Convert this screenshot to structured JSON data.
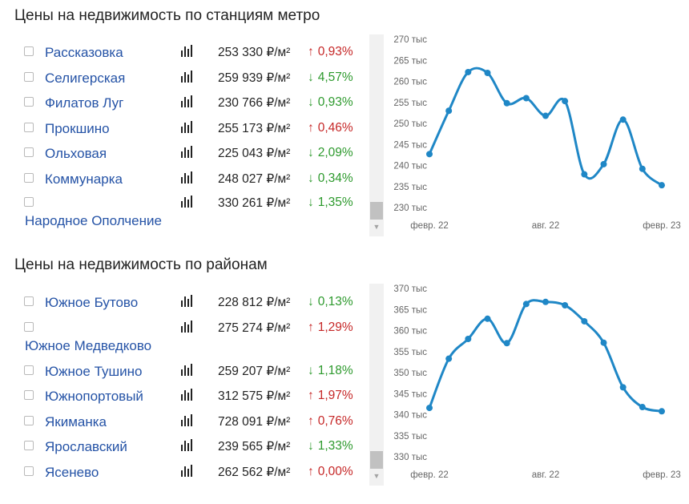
{
  "sections": [
    {
      "title": "Цены на недвижимость по станциям метро",
      "rows": [
        {
          "name": "Рассказовка",
          "price": "253 330 ₽/м²",
          "dir": "up",
          "arrow": "↑",
          "change": "0,93%",
          "wrap": false
        },
        {
          "name": "Селигерская",
          "price": "259 939 ₽/м²",
          "dir": "down",
          "arrow": "↓",
          "change": "4,57%",
          "wrap": false
        },
        {
          "name": "Филатов Луг",
          "price": "230 766 ₽/м²",
          "dir": "down",
          "arrow": "↓",
          "change": "0,93%",
          "wrap": false
        },
        {
          "name": "Прокшино",
          "price": "255 173 ₽/м²",
          "dir": "up",
          "arrow": "↑",
          "change": "0,46%",
          "wrap": false
        },
        {
          "name": "Ольховая",
          "price": "225 043 ₽/м²",
          "dir": "down",
          "arrow": "↓",
          "change": "2,09%",
          "wrap": false
        },
        {
          "name": "Коммунарка",
          "price": "248 027 ₽/м²",
          "dir": "down",
          "arrow": "↓",
          "change": "0,34%",
          "wrap": false
        },
        {
          "name": "Народное Ополчение",
          "price": "330 261 ₽/м²",
          "dir": "down",
          "arrow": "↓",
          "change": "1,35%",
          "wrap": true
        }
      ]
    },
    {
      "title": "Цены на недвижимость по районам",
      "rows": [
        {
          "name": "Южное Бутово",
          "price": "228 812 ₽/м²",
          "dir": "down",
          "arrow": "↓",
          "change": "0,13%",
          "wrap": false
        },
        {
          "name": "Южное Медведково",
          "price": "275 274 ₽/м²",
          "dir": "up",
          "arrow": "↑",
          "change": "1,29%",
          "wrap": true
        },
        {
          "name": "Южное Тушино",
          "price": "259 207 ₽/м²",
          "dir": "down",
          "arrow": "↓",
          "change": "1,18%",
          "wrap": false
        },
        {
          "name": "Южнопортовый",
          "price": "312 575 ₽/м²",
          "dir": "up",
          "arrow": "↑",
          "change": "1,97%",
          "wrap": false
        },
        {
          "name": "Якиманка",
          "price": "728 091 ₽/м²",
          "dir": "up",
          "arrow": "↑",
          "change": "0,76%",
          "wrap": false
        },
        {
          "name": "Ярославский",
          "price": "239 565 ₽/м²",
          "dir": "down",
          "arrow": "↓",
          "change": "1,33%",
          "wrap": false
        },
        {
          "name": "Ясенево",
          "price": "262 562 ₽/м²",
          "dir": "up",
          "arrow": "↑",
          "change": "0,00%",
          "wrap": false
        }
      ]
    }
  ],
  "colors": {
    "line": "#1f87c6",
    "up": "#c62828",
    "down": "#2e9a2e",
    "link": "#2553a6"
  },
  "chart_data": [
    {
      "type": "line",
      "title": "",
      "x_ticks": [
        "февр. 22",
        "авг. 22",
        "февр. 23"
      ],
      "x": [
        "2022-02",
        "2022-03",
        "2022-04",
        "2022-05",
        "2022-06",
        "2022-07",
        "2022-08",
        "2022-09",
        "2022-10",
        "2022-11",
        "2022-12",
        "2023-01",
        "2023-02"
      ],
      "series": [
        {
          "values": [
            242.7,
            253.0,
            262.2,
            262.0,
            254.8,
            256.0,
            251.8,
            255.3,
            237.9,
            240.3,
            250.9,
            239.2,
            235.3
          ]
        }
      ],
      "ylim": [
        230,
        270
      ],
      "y_ticks": [
        230,
        235,
        240,
        245,
        250,
        255,
        260,
        265,
        270
      ],
      "y_tick_labels": [
        "230 тыс",
        "235 тыс",
        "240 тыс",
        "245 тыс",
        "250 тыс",
        "255 тыс",
        "260 тыс",
        "265 тыс",
        "270 тыс"
      ],
      "grid": false
    },
    {
      "type": "line",
      "title": "",
      "x_ticks": [
        "февр. 22",
        "авг. 22",
        "февр. 23"
      ],
      "x": [
        "2022-02",
        "2022-03",
        "2022-04",
        "2022-05",
        "2022-06",
        "2022-07",
        "2022-08",
        "2022-09",
        "2022-10",
        "2022-11",
        "2022-12",
        "2023-01",
        "2023-02"
      ],
      "series": [
        {
          "values": [
            341.6,
            353.3,
            358.0,
            362.8,
            357.0,
            366.3,
            366.8,
            366.0,
            362.2,
            357.1,
            346.5,
            341.8,
            340.8
          ]
        }
      ],
      "ylim": [
        330,
        370
      ],
      "y_ticks": [
        330,
        335,
        340,
        345,
        350,
        355,
        360,
        365,
        370
      ],
      "y_tick_labels": [
        "330 тыс",
        "335 тыс",
        "340 тыс",
        "345 тыс",
        "350 тыс",
        "355 тыс",
        "360 тыс",
        "365 тыс",
        "370 тыс"
      ],
      "grid": false
    }
  ]
}
